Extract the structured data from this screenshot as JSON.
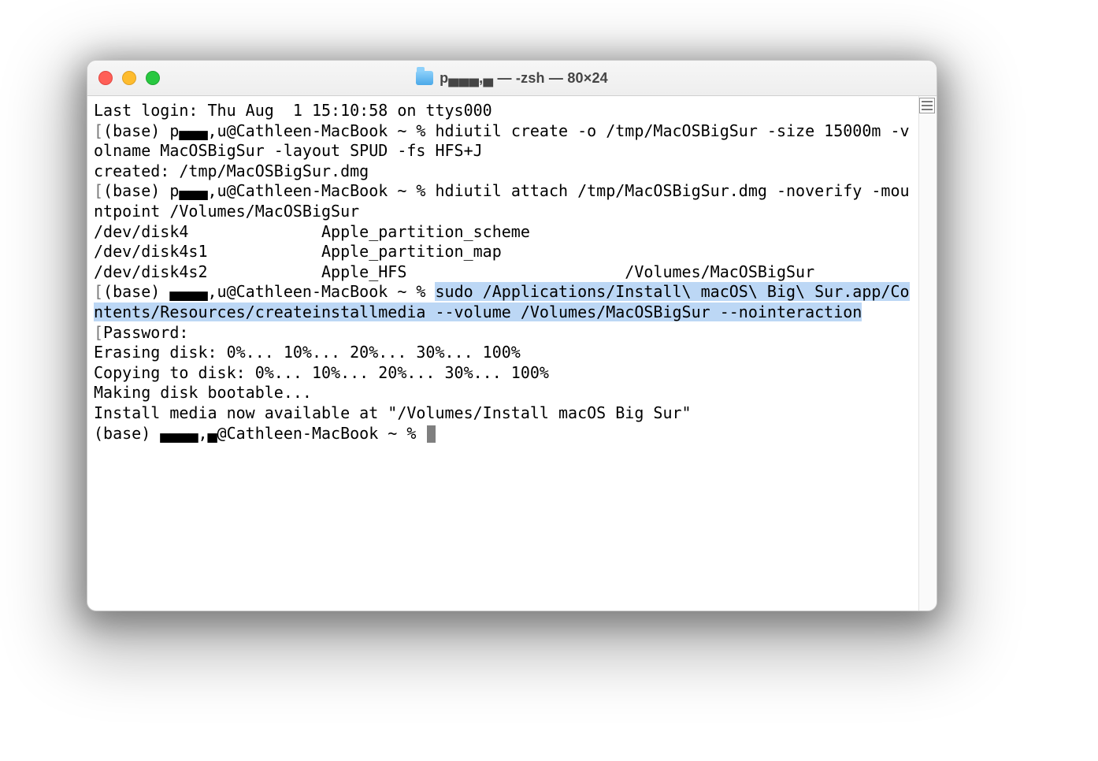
{
  "window": {
    "title": "p▄▄▄,▄ — -zsh — 80×24"
  },
  "terminal": {
    "line_last_login": "Last login: Thu Aug  1 15:10:58 on ttys000",
    "prompt1_pre": "(base) p▄▄▄,u@Cathleen-MacBook ~ % ",
    "cmd1": "hdiutil create -o /tmp/MacOSBigSur -size 15000m -volname MacOSBigSur -layout SPUD -fs HFS+J",
    "out1": "created: /tmp/MacOSBigSur.dmg",
    "prompt2_pre": "(base) p▄▄▄,u@Cathleen-MacBook ~ % ",
    "cmd2": "hdiutil attach /tmp/MacOSBigSur.dmg -noverify -mountpoint /Volumes/MacOSBigSur",
    "out2a": "/dev/disk4          \tApple_partition_scheme         \t",
    "out2b": "/dev/disk4s1        \tApple_partition_map            \t",
    "out2c": "/dev/disk4s2        \tApple_HFS                      \t/Volumes/MacOSBigSur",
    "prompt3_pre": "(base) ▄▄▄▄,u@Cathleen-MacBook ~ % ",
    "cmd3_sel": "sudo /Applications/Install\\ macOS\\ Big\\ Sur.app/Contents/Resources/createinstallmedia --volume /Volumes/MacOSBigSur --nointeraction",
    "password": "Password:",
    "erasing": "Erasing disk: 0%... 10%... 20%... 30%... 100%",
    "copying": "Copying to disk: 0%... 10%... 20%... 30%... 100%",
    "making": "Making disk bootable...",
    "done": "Install media now available at \"/Volumes/Install macOS Big Sur\"",
    "prompt4": "(base) ▄▄▄▄,▄@Cathleen-MacBook ~ % "
  }
}
